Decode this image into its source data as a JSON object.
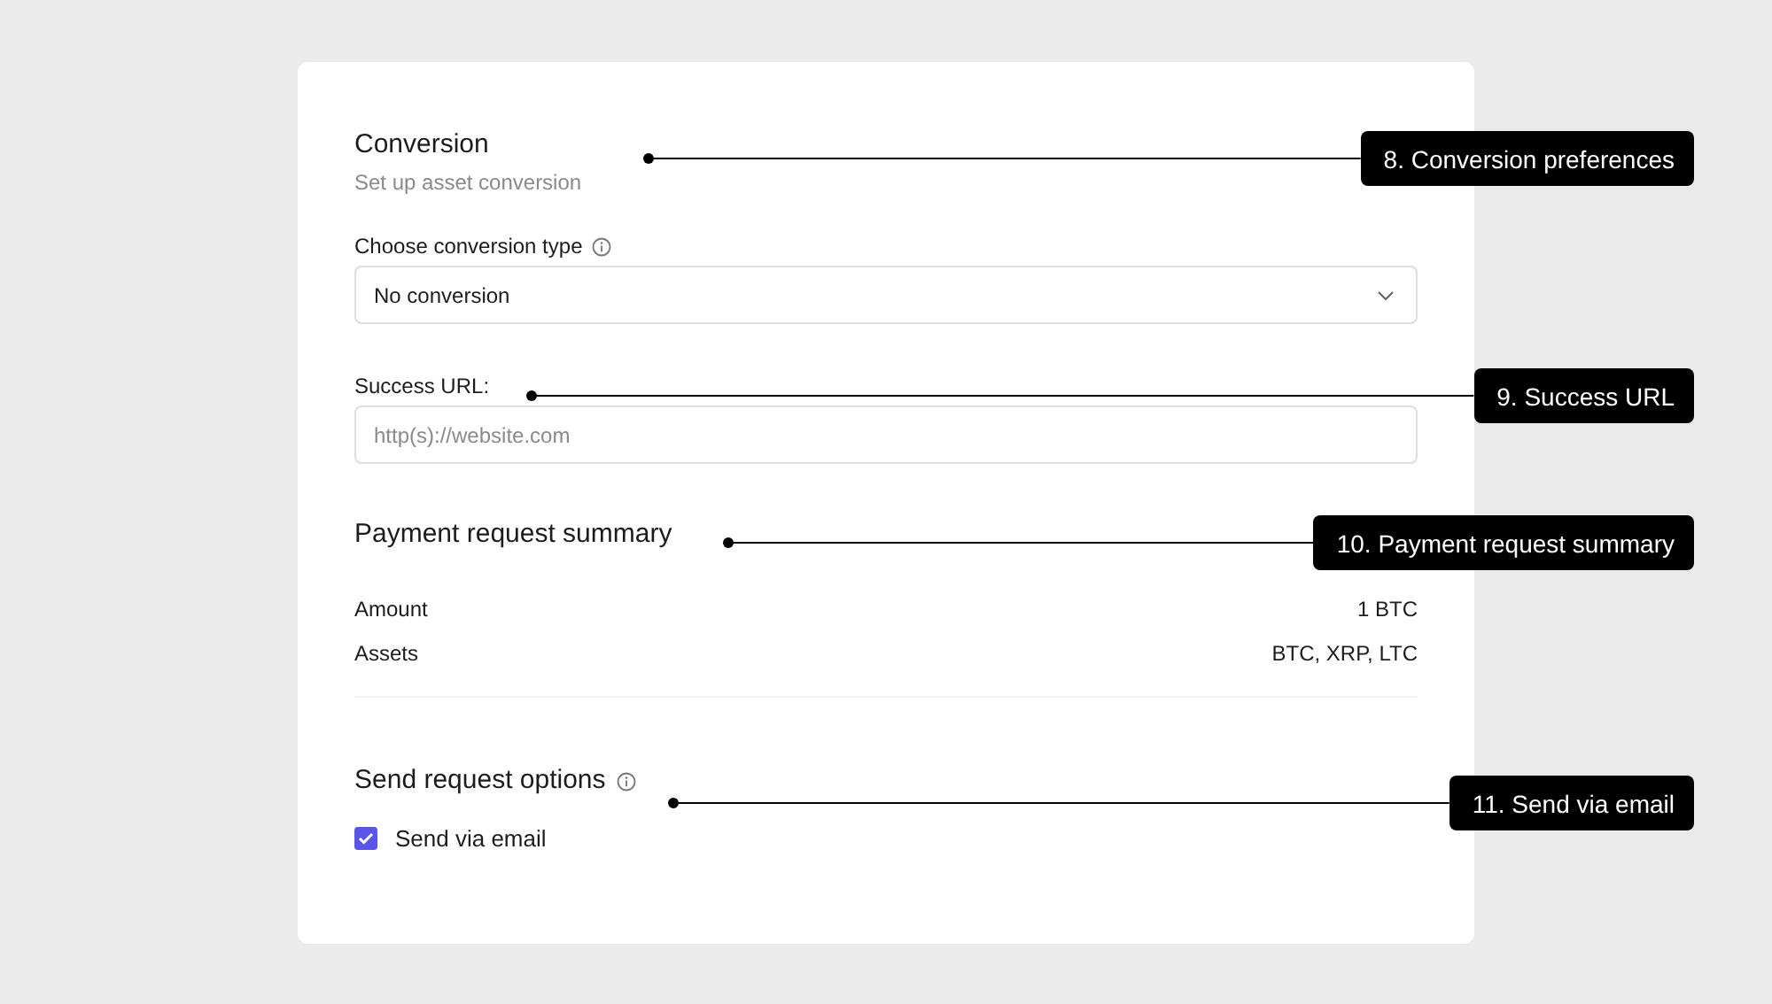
{
  "conversion": {
    "title": "Conversion",
    "subtitle": "Set up asset conversion",
    "type_label": "Choose conversion type",
    "type_value": "No conversion"
  },
  "success_url": {
    "label": "Success URL:",
    "placeholder": "http(s)://website.com"
  },
  "summary": {
    "title": "Payment request summary",
    "rows": [
      {
        "label": "Amount",
        "value": "1 BTC"
      },
      {
        "label": "Assets",
        "value": "BTC, XRP, LTC"
      }
    ]
  },
  "send_options": {
    "title": "Send request options",
    "options": [
      {
        "label": "Send via email",
        "checked": true
      }
    ]
  },
  "callouts": [
    {
      "text": "8. Conversion preferences"
    },
    {
      "text": "9. Success URL"
    },
    {
      "text": "10. Payment request summary"
    },
    {
      "text": "11. Send via email"
    }
  ]
}
